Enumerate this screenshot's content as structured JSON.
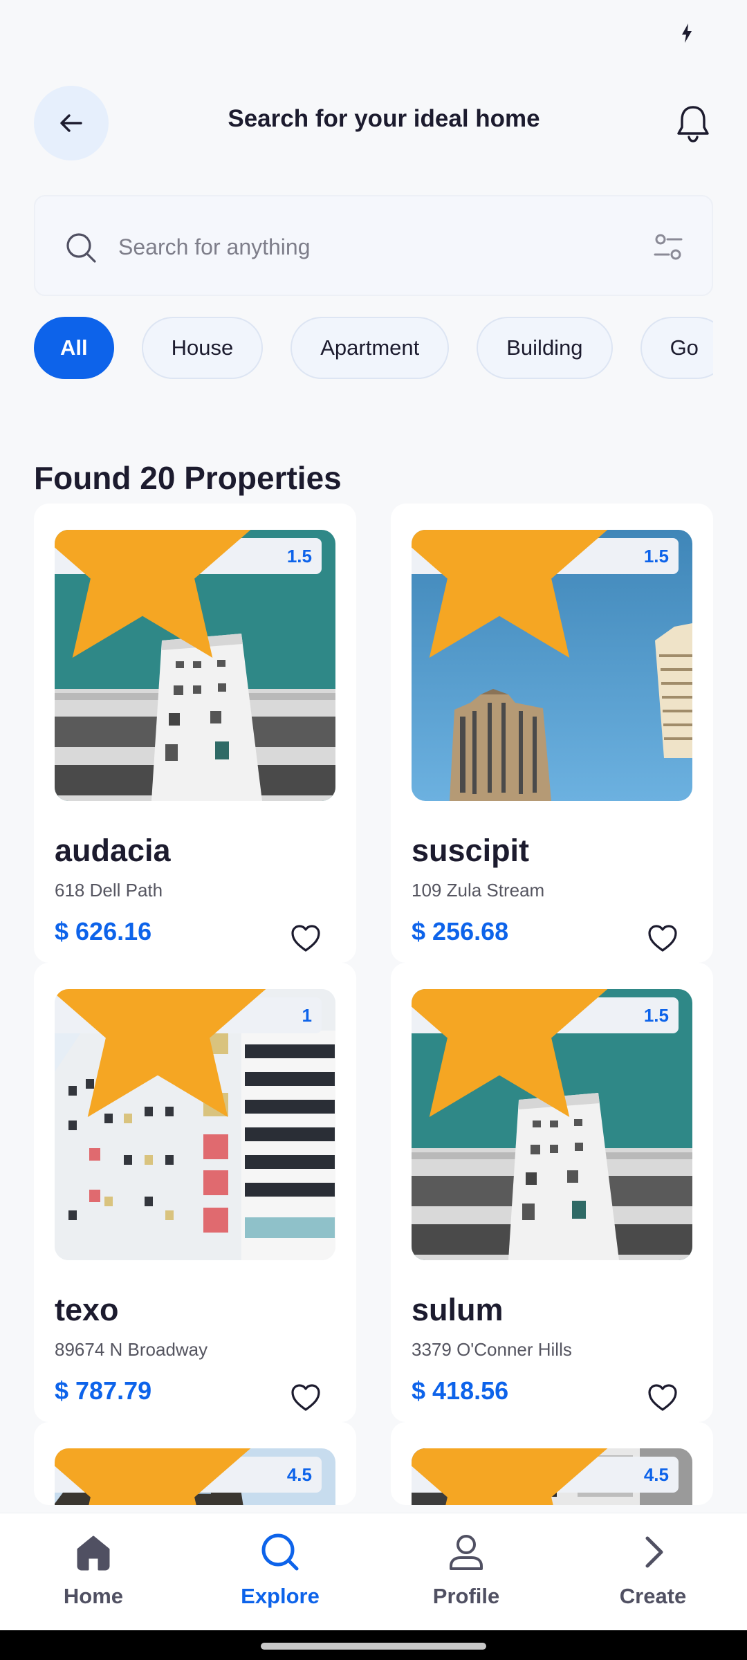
{
  "status_bar": {
    "icon": "charging-bolt-icon"
  },
  "header": {
    "title": "Search for your ideal home",
    "back_icon": "arrow-left-icon",
    "notification_icon": "bell-icon"
  },
  "search": {
    "placeholder": "Search for anything",
    "value": "",
    "icon": "search-icon",
    "filter_icon": "filter-sliders-icon"
  },
  "filters": {
    "selected": "All",
    "chips": [
      "All",
      "House",
      "Apartment",
      "Building",
      "Go"
    ]
  },
  "results": {
    "title": "Found 20 Properties"
  },
  "properties": [
    {
      "name": "audacia",
      "address": "618 Dell Path",
      "price": "$ 626.16",
      "rating": "1.5"
    },
    {
      "name": "suscipit",
      "address": "109 Zula Stream",
      "price": "$ 256.68",
      "rating": "1.5"
    },
    {
      "name": "texo",
      "address": "89674 N Broadway",
      "price": "$ 787.79",
      "rating": "1"
    },
    {
      "name": "sulum",
      "address": "3379 O'Conner Hills",
      "price": "$ 418.56",
      "rating": "1.5"
    },
    {
      "name": "",
      "address": "",
      "price": "",
      "rating": "4.5"
    },
    {
      "name": "",
      "address": "",
      "price": "",
      "rating": "4.5"
    }
  ],
  "bottom_nav": {
    "active": "Explore",
    "items": [
      {
        "label": "Home",
        "icon": "home-icon"
      },
      {
        "label": "Explore",
        "icon": "search-icon"
      },
      {
        "label": "Profile",
        "icon": "person-icon"
      },
      {
        "label": "Create",
        "icon": "chevron-right-icon"
      }
    ]
  },
  "colors": {
    "accent": "#0d63ea",
    "text": "#1c1b2e",
    "star": "#f5a623",
    "background": "#f7f8fa"
  }
}
